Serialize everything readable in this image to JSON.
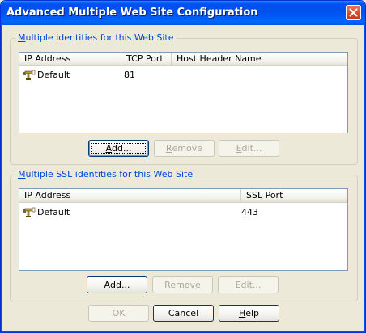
{
  "window": {
    "title": "Advanced Multiple Web Site Configuration",
    "close_icon": "close-x-icon"
  },
  "colors": {
    "titlebar": "#0053ee",
    "group_title": "#0046d5",
    "dialog_bg": "#ece9d8",
    "close_button": "#d84a2a"
  },
  "identities": {
    "group_title_accel": "M",
    "group_title_rest": "ultiple identities for this Web Site",
    "columns": [
      "IP Address",
      "TCP Port",
      "Host Header Name"
    ],
    "rows": [
      {
        "icon": "network-node-icon",
        "ip": "Default",
        "port": "81",
        "host": ""
      }
    ],
    "buttons": {
      "add_accel": "A",
      "add_rest": "dd...",
      "remove_accel": "R",
      "remove_rest": "emove",
      "edit_accel": "E",
      "edit_rest": "dit..."
    }
  },
  "ssl": {
    "group_title_accel": "M",
    "group_title_rest": "ultiple SSL identities for this Web Site",
    "columns": [
      "IP Address",
      "SSL Port"
    ],
    "rows": [
      {
        "icon": "network-node-icon",
        "ip": "Default",
        "port": "443"
      }
    ],
    "buttons": {
      "add_accel": "A",
      "add_rest": "dd...",
      "remove_accel": "m",
      "remove_pre": "Re",
      "remove_rest": "ove",
      "edit_accel": "d",
      "edit_pre": "E",
      "edit_rest": "it..."
    }
  },
  "footer": {
    "ok": "OK",
    "cancel": "Cancel",
    "help_accel": "H",
    "help_rest": "elp"
  }
}
